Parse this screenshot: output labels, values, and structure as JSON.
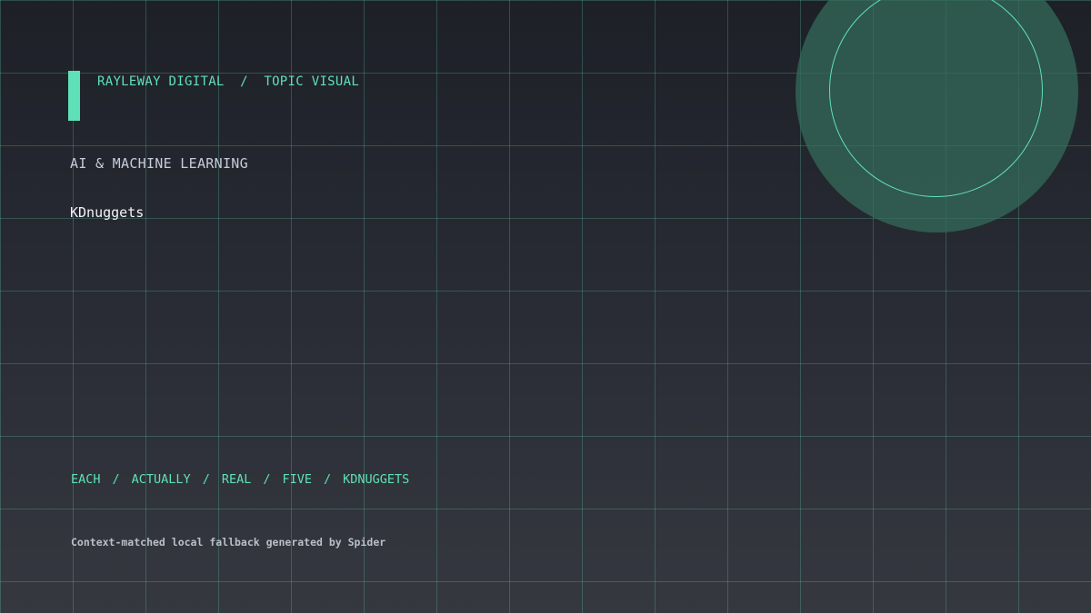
{
  "header": {
    "brand": "RAYLEWAY DIGITAL",
    "separator": "/",
    "label": "TOPIC VISUAL"
  },
  "main": {
    "topic": "AI & MACHINE LEARNING",
    "source": "KDnuggets"
  },
  "tags": [
    "EACH",
    "ACTUALLY",
    "REAL",
    "FIVE",
    "KDNUGGETS"
  ],
  "tag_separator": "/",
  "footer": {
    "note": "Context-matched local fallback generated by Spider"
  },
  "colors": {
    "accent": "#5fe0b8",
    "background": "#23262d",
    "grid_line": "#3f6b62",
    "orb": "#2f5a4e"
  }
}
